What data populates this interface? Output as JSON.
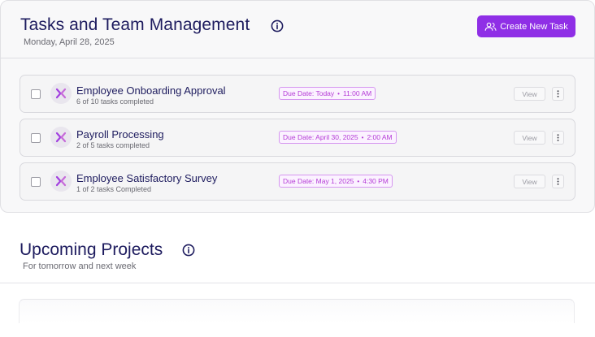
{
  "tasks_section": {
    "title": "Tasks and Team Management",
    "date": "Monday, April 28, 2025",
    "create_button_label": "Create New Task",
    "tasks": [
      {
        "name": "Employee Onboarding Approval",
        "progress": "6 of 10 tasks completed",
        "due_label": "Due Date: Today",
        "due_time": "11:00 AM",
        "view_label": "View"
      },
      {
        "name": "Payroll Processing",
        "progress": "2 of 5 tasks completed",
        "due_label": "Due Date: April 30, 2025",
        "due_time": "2:00 AM",
        "view_label": "View"
      },
      {
        "name": "Employee Satisfactory Survey",
        "progress": "1 of 2 tasks Completed",
        "due_label": "Due Date: May 1, 2025",
        "due_time": "4:30 PM",
        "view_label": "View"
      }
    ]
  },
  "upcoming_section": {
    "title": "Upcoming Projects",
    "subtitle": "For tomorrow and next week"
  },
  "colors": {
    "accent": "#8f2fe6",
    "heading": "#1d1b5e",
    "due_badge": "#b43bd6"
  },
  "icons": {
    "info": "info-circle-icon",
    "create_task": "users-icon",
    "task_avatar": "brand-x-logo-icon",
    "more": "vertical-dots-icon"
  }
}
